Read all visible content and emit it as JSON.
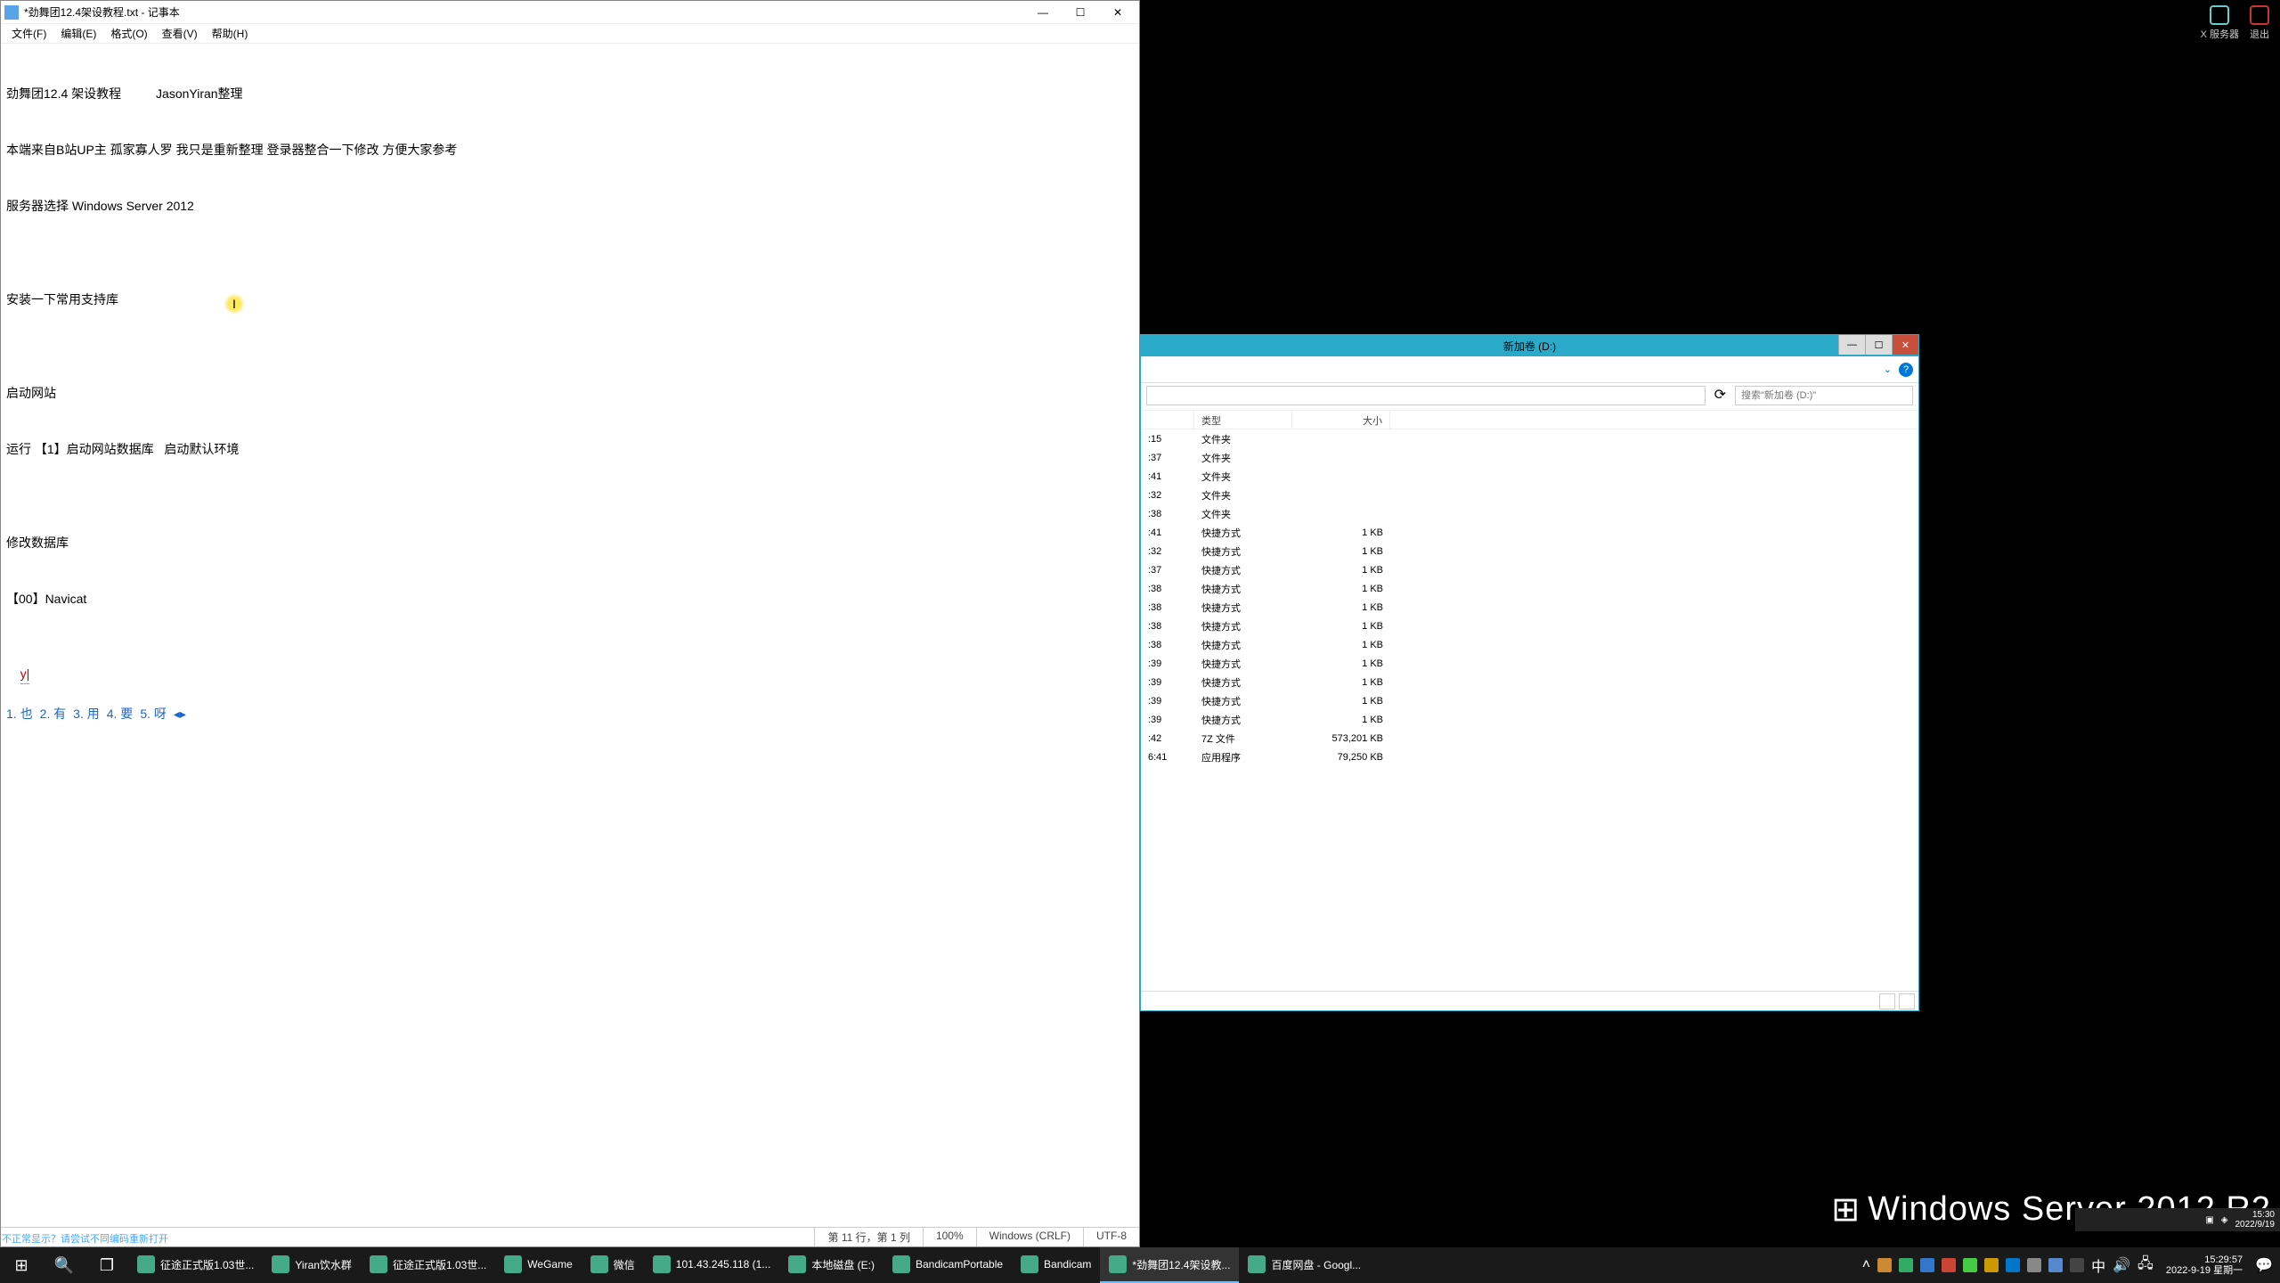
{
  "notepad": {
    "title": "*劲舞团12.4架设教程.txt - 记事本",
    "menu": [
      "文件(F)",
      "编辑(E)",
      "格式(O)",
      "查看(V)",
      "帮助(H)"
    ],
    "content": {
      "l1": "劲舞团12.4 架设教程          JasonYiran整理",
      "l2": "本端来自B站UP主 孤家寡人罗 我只是重新整理 登录器整合一下修改 方便大家参考",
      "l3": "服务器选择 Windows Server 2012",
      "l4": "",
      "l5": "安装一下常用支持库",
      "l6": "",
      "l7": "启动网站",
      "l8": "运行 【1】启动网站数据库   启动默认环境",
      "l9": "",
      "l10": "修改数据库",
      "l11": "【00】Navicat",
      "l12": ""
    },
    "ime_input": "y|",
    "ime_candidates": [
      "1. 也",
      "2. 有",
      "3. 用",
      "4. 要",
      "5. 呀"
    ],
    "status": {
      "pos": "第 11 行，第 1 列",
      "zoom": "100%",
      "eol": "Windows (CRLF)",
      "enc": "UTF-8"
    }
  },
  "remote_top": {
    "server": "X 服务器",
    "exit": "退出"
  },
  "explorer": {
    "title": "新加卷 (D:)",
    "search_ph": "搜索\"新加卷 (D:)\"",
    "cols": {
      "date": "",
      "type": "类型",
      "size": "大小"
    },
    "rows": [
      {
        "d": ":15",
        "t": "文件夹",
        "s": ""
      },
      {
        "d": ":37",
        "t": "文件夹",
        "s": ""
      },
      {
        "d": ":41",
        "t": "文件夹",
        "s": ""
      },
      {
        "d": ":32",
        "t": "文件夹",
        "s": ""
      },
      {
        "d": ":38",
        "t": "文件夹",
        "s": ""
      },
      {
        "d": ":41",
        "t": "快捷方式",
        "s": "1 KB"
      },
      {
        "d": ":32",
        "t": "快捷方式",
        "s": "1 KB"
      },
      {
        "d": ":37",
        "t": "快捷方式",
        "s": "1 KB"
      },
      {
        "d": ":38",
        "t": "快捷方式",
        "s": "1 KB"
      },
      {
        "d": ":38",
        "t": "快捷方式",
        "s": "1 KB"
      },
      {
        "d": ":38",
        "t": "快捷方式",
        "s": "1 KB"
      },
      {
        "d": ":38",
        "t": "快捷方式",
        "s": "1 KB"
      },
      {
        "d": ":39",
        "t": "快捷方式",
        "s": "1 KB"
      },
      {
        "d": ":39",
        "t": "快捷方式",
        "s": "1 KB"
      },
      {
        "d": ":39",
        "t": "快捷方式",
        "s": "1 KB"
      },
      {
        "d": ":39",
        "t": "快捷方式",
        "s": "1 KB"
      },
      {
        "d": ":42",
        "t": "7Z 文件",
        "s": "573,201 KB"
      },
      {
        "d": "6:41",
        "t": "应用程序",
        "s": "79,250 KB"
      }
    ]
  },
  "watermark": "Windows Server 2012 R2",
  "remote_tb": {
    "time": "15:30",
    "date": "2022/9/19"
  },
  "taskbar": {
    "items": [
      {
        "label": "征途正式版1.03世..."
      },
      {
        "label": "Yiran饮水群"
      },
      {
        "label": "征途正式版1.03世..."
      },
      {
        "label": "WeGame"
      },
      {
        "label": "微信"
      },
      {
        "label": "101.43.245.118 (1..."
      },
      {
        "label": "本地磁盘 (E:)"
      },
      {
        "label": "BandicamPortable"
      },
      {
        "label": "Bandicam"
      },
      {
        "label": "*劲舞团12.4架设教..."
      },
      {
        "label": "百度网盘 - Googl..."
      }
    ],
    "clock": {
      "t": "15:29:57",
      "d": "2022-9-19 星期一"
    }
  },
  "statusline_hint": "不正常显示？请尝试不同编码重新打开"
}
